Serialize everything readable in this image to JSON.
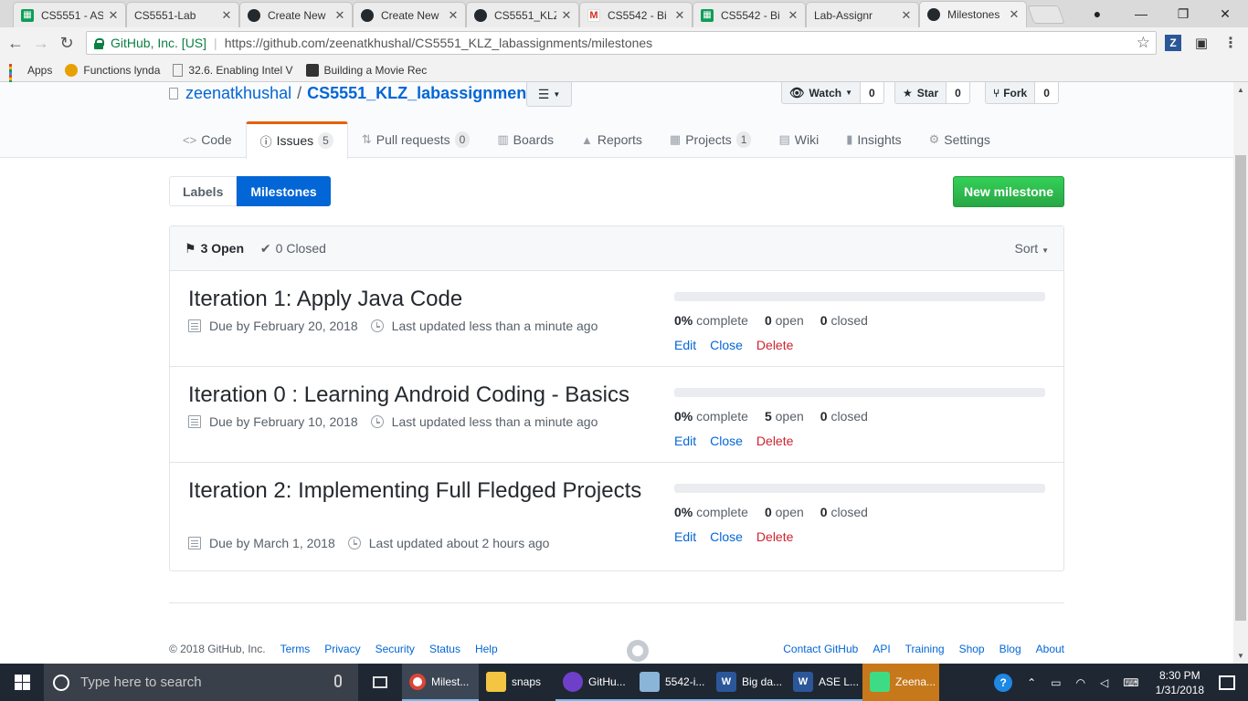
{
  "browser": {
    "tabs": [
      {
        "title": "CS5551 - AS",
        "icon": "sheets"
      },
      {
        "title": "CS5551-Lab",
        "icon": "box"
      },
      {
        "title": "Create New",
        "icon": "github"
      },
      {
        "title": "Create New",
        "icon": "github"
      },
      {
        "title": "CS5551_KLZ",
        "icon": "github"
      },
      {
        "title": "CS5542 - Bi",
        "icon": "gmail"
      },
      {
        "title": "CS5542 - Bi",
        "icon": "sheets"
      },
      {
        "title": "Lab-Assignr",
        "icon": "box"
      },
      {
        "title": "Milestones",
        "icon": "github",
        "active": true
      }
    ],
    "address": {
      "secure_label": "GitHub, Inc. [US]",
      "url": "https://github.com/zeenatkhushal/CS5551_KLZ_labassignments/milestones"
    },
    "bookmarks": [
      "Apps",
      "Functions lynda",
      "32.6. Enabling Intel V",
      "Building a Movie Rec"
    ]
  },
  "repo": {
    "owner": "zeenatkhushal",
    "separator": "/",
    "name": "CS5551_KLZ_labassignments",
    "watch_label": "Watch",
    "watch_count": "0",
    "star_label": "Star",
    "star_count": "0",
    "fork_label": "Fork",
    "fork_count": "0"
  },
  "reponav": {
    "code": "Code",
    "issues": "Issues",
    "issues_count": "5",
    "pulls": "Pull requests",
    "pulls_count": "0",
    "boards": "Boards",
    "reports": "Reports",
    "projects": "Projects",
    "projects_count": "1",
    "wiki": "Wiki",
    "insights": "Insights",
    "settings": "Settings"
  },
  "subnav": {
    "labels": "Labels",
    "milestones": "Milestones",
    "new_milestone": "New milestone"
  },
  "list": {
    "open_label": "3 Open",
    "closed_label": "0 Closed",
    "sort_label": "Sort",
    "milestones": [
      {
        "title": "Iteration 1: Apply Java Code",
        "due": "Due by February 20, 2018",
        "updated": "Last updated less than a minute ago",
        "percent": "0%",
        "complete_label": "complete",
        "open": "0",
        "open_label": "open",
        "closed": "0",
        "closed_label": "closed",
        "progress": 0
      },
      {
        "title": "Iteration 0 : Learning Android Coding - Basics",
        "due": "Due by February 10, 2018",
        "updated": "Last updated less than a minute ago",
        "percent": "0%",
        "complete_label": "complete",
        "open": "5",
        "open_label": "open",
        "closed": "0",
        "closed_label": "closed",
        "progress": 0
      },
      {
        "title": "Iteration 2: Implementing Full Fledged Projects",
        "due": "Due by March 1, 2018",
        "updated": "Last updated about 2 hours ago",
        "percent": "0%",
        "complete_label": "complete",
        "open": "0",
        "open_label": "open",
        "closed": "0",
        "closed_label": "closed",
        "progress": 0
      }
    ],
    "actions": {
      "edit": "Edit",
      "close": "Close",
      "delete": "Delete"
    }
  },
  "footer": {
    "copyright": "© 2018 GitHub, Inc.",
    "left_links": [
      "Terms",
      "Privacy",
      "Security",
      "Status",
      "Help"
    ],
    "right_links": [
      "Contact GitHub",
      "API",
      "Training",
      "Shop",
      "Blog",
      "About"
    ]
  },
  "taskbar": {
    "search_placeholder": "Type here to search",
    "items": [
      {
        "label": "Milest...",
        "icon": "chrome-icon"
      },
      {
        "label": "snaps",
        "icon": "folder-icon"
      },
      {
        "label": "GitHu...",
        "icon": "github-desktop-icon"
      },
      {
        "label": "5542-i...",
        "icon": "paint-icon"
      },
      {
        "label": "Big da...",
        "icon": "word-icon"
      },
      {
        "label": "ASE L...",
        "icon": "word-icon"
      },
      {
        "label": "Zeena...",
        "icon": "android-studio-icon"
      }
    ],
    "time": "8:30 PM",
    "date": "1/31/2018"
  },
  "colors": {
    "link": "#0366d6",
    "primary_green": "#28a745",
    "selected_tab_accent": "#e36209",
    "delete_red": "#cb2431"
  }
}
